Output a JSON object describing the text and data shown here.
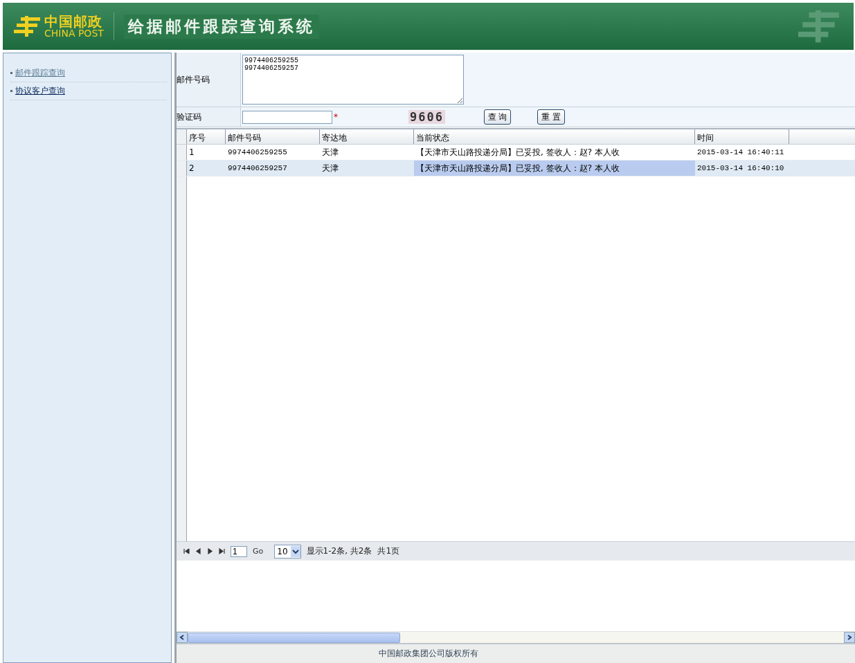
{
  "header": {
    "logo_cn": "中国邮政",
    "logo_en": "CHINA POST",
    "title": "给据邮件跟踪查询系统"
  },
  "sidebar": {
    "items": [
      {
        "label": "邮件跟踪查询",
        "visited": true
      },
      {
        "label": "协议客户查询",
        "visited": false
      }
    ]
  },
  "form": {
    "tracking_label": "邮件号码",
    "tracking_value": "9974406259255\n9974406259257",
    "captcha_label": "验证码",
    "required_mark": "*",
    "captcha_image": "9606",
    "buttons": [
      "查 询",
      "重 置"
    ]
  },
  "table": {
    "columns": [
      "序号",
      "邮件号码",
      "寄达地",
      "当前状态",
      "时间"
    ],
    "rows": [
      {
        "cells": [
          "1",
          "9974406259255",
          "天津",
          "【天津市天山路投递分局】已妥投, 签收人：赵? 本人收",
          "2015-03-14 16:40:11"
        ],
        "selected": false
      },
      {
        "cells": [
          "2",
          "9974406259257",
          "天津",
          "【天津市天山路投递分局】已妥投, 签收人：赵? 本人收",
          "2015-03-14 16:40:10"
        ],
        "selected": true
      }
    ]
  },
  "pager": {
    "page": "1",
    "go": "Go",
    "page_size": "10",
    "info": "显示1-2条, 共2条",
    "pages": "共1页"
  },
  "footer": "中国邮政集团公司版权所有"
}
